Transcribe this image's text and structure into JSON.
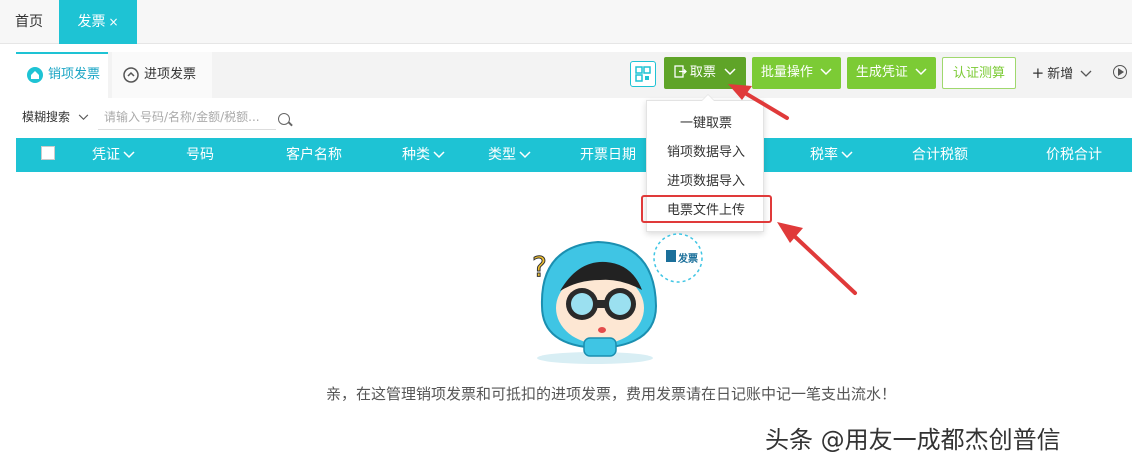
{
  "top_tabs": {
    "home": "首页",
    "invoice": "发票",
    "close": "×"
  },
  "sub_tabs": {
    "sales": "销项发票",
    "purchase": "进项发票"
  },
  "toolbar": {
    "take_invoice": "取票",
    "batch_ops": "批量操作",
    "gen_voucher": "生成凭证",
    "auth_calc": "认证测算",
    "new": "新增"
  },
  "search": {
    "mode": "模糊搜索",
    "placeholder": "请输入号码/名称/金额/税额..."
  },
  "table": {
    "headers": [
      "凭证",
      "号码",
      "客户名称",
      "种类",
      "类型",
      "开票日期",
      "税率",
      "合计税额",
      "价税合计"
    ]
  },
  "dropdown_items": [
    "一键取票",
    "销项数据导入",
    "进项数据导入",
    "电票文件上传"
  ],
  "empty": {
    "message": "亲，在这管理销项发票和可抵扣的进项发票，费用发票请在日记账中记一笔支出流水！",
    "bubble_text": "发票"
  },
  "watermark": "头条 @用友一成都杰创普信",
  "colors": {
    "primary": "#1ec3d4",
    "green_dark": "#5fa428",
    "green": "#7ccb35",
    "annotation_red": "#e03a3a"
  }
}
